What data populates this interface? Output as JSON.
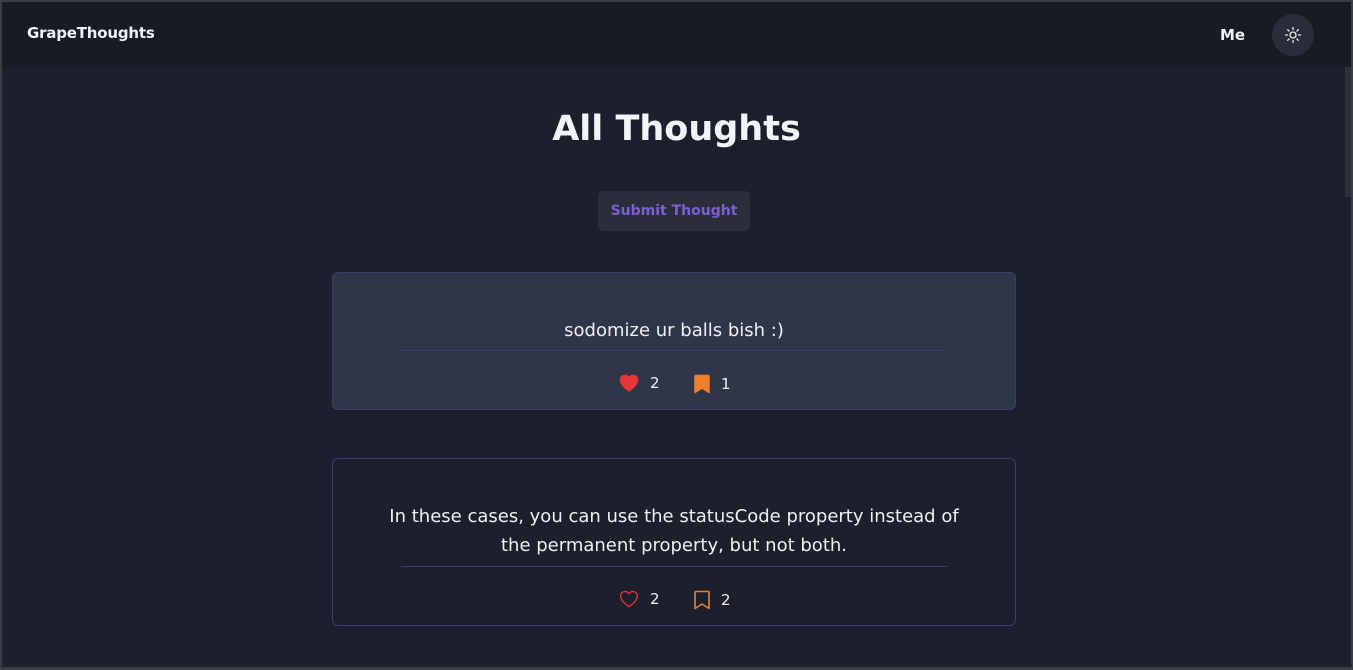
{
  "navbar": {
    "brand": "GrapeThoughts",
    "me_label": "Me",
    "theme_icon": "sun-icon"
  },
  "page": {
    "title": "All Thoughts",
    "submit_label": "Submit Thought"
  },
  "thoughts": [
    {
      "text": "sodomize ur balls bish :)",
      "likes": "2",
      "bookmarks": "1",
      "liked": true,
      "bookmarked": true
    },
    {
      "text": "In these cases, you can use the statusCode property instead of the permanent property, but not both.",
      "likes": "2",
      "bookmarks": "2",
      "liked": false,
      "bookmarked": false
    }
  ],
  "colors": {
    "heart": "#e5363b",
    "bookmark": "#ee7f2c",
    "accent": "#7c5fd0"
  }
}
